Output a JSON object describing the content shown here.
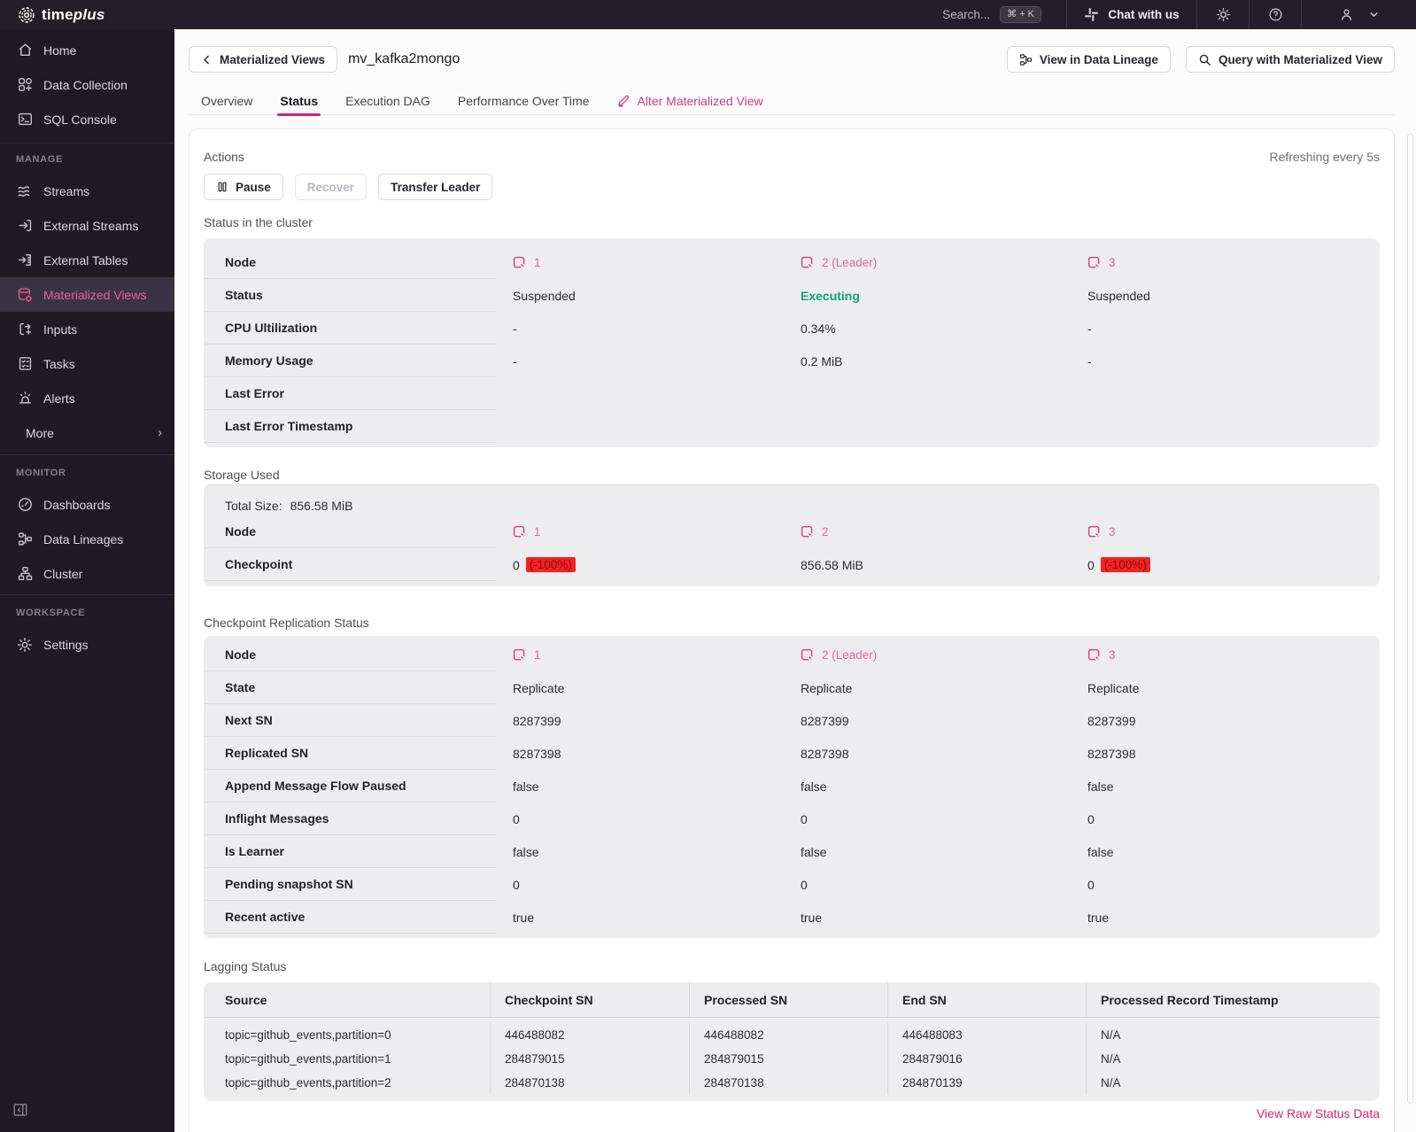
{
  "colors": {
    "brand_pink": "#d6246d",
    "node_pink": "#e2699c",
    "green_executing": "#0ea371",
    "error_badge_bg": "#f42121",
    "error_badge_text": "#7e1111",
    "sidebar_bg": "#1e1b26",
    "topbar_bg": "#221f2a"
  },
  "brand": {
    "name_regular": "time",
    "name_italic": "plus",
    "icon": "timeplus-rings-icon"
  },
  "topbar": {
    "search_label": "Search...",
    "search_shortcut": "⌘ + K",
    "chat_label": "Chat with us",
    "icons": [
      "slack-icon",
      "sun-icon",
      "help-icon",
      "user-icon",
      "chevron-down-icon"
    ]
  },
  "sidebar": {
    "primary": [
      {
        "label": "Home",
        "icon": "home-icon"
      },
      {
        "label": "Data Collection",
        "icon": "data-collection-icon"
      },
      {
        "label": "SQL Console",
        "icon": "sql-console-icon"
      }
    ],
    "sections": [
      {
        "title": "MANAGE",
        "items": [
          {
            "label": "Streams",
            "icon": "streams-icon"
          },
          {
            "label": "External Streams",
            "icon": "external-streams-icon"
          },
          {
            "label": "External Tables",
            "icon": "external-tables-icon"
          },
          {
            "label": "Materialized Views",
            "icon": "materialized-views-icon",
            "active": true
          },
          {
            "label": "Inputs",
            "icon": "inputs-icon"
          },
          {
            "label": "Tasks",
            "icon": "tasks-icon"
          },
          {
            "label": "Alerts",
            "icon": "alerts-icon"
          },
          {
            "label": "More",
            "icon": "",
            "chevron": "›"
          }
        ]
      },
      {
        "title": "MONITOR",
        "items": [
          {
            "label": "Dashboards",
            "icon": "dashboards-icon"
          },
          {
            "label": "Data Lineages",
            "icon": "data-lineages-icon"
          },
          {
            "label": "Cluster",
            "icon": "cluster-icon"
          }
        ]
      },
      {
        "title": "WORKSPACE",
        "items": [
          {
            "label": "Settings",
            "icon": "settings-icon"
          }
        ]
      }
    ]
  },
  "header": {
    "back_label": "Materialized Views",
    "title": "mv_kafka2mongo",
    "lineage_button": "View in Data Lineage",
    "query_button": "Query with Materialized View"
  },
  "tabs": {
    "items": [
      {
        "label": "Overview"
      },
      {
        "label": "Status",
        "active": true
      },
      {
        "label": "Execution DAG"
      },
      {
        "label": "Performance Over Time"
      }
    ],
    "alter_label": "Alter Materialized View"
  },
  "panel": {
    "actions_title": "Actions",
    "refresh_note": "Refreshing every 5s",
    "pause_label": "Pause",
    "recover_label": "Recover",
    "transfer_label": "Transfer Leader",
    "cluster": {
      "title": "Status in the cluster",
      "labels": {
        "node": "Node",
        "status": "Status",
        "cpu": "CPU Ultilization",
        "memory": "Memory Usage",
        "last_error": "Last Error",
        "last_error_ts": "Last Error Timestamp"
      },
      "nodes": [
        {
          "id": "1",
          "status": "Suspended",
          "cpu": "-",
          "memory": "-",
          "last_error": "",
          "last_error_ts": ""
        },
        {
          "id": "2 (Leader)",
          "status": "Executing",
          "cpu": "0.34%",
          "memory": "0.2 MiB",
          "last_error": "",
          "last_error_ts": ""
        },
        {
          "id": "3",
          "status": "Suspended",
          "cpu": "-",
          "memory": "-",
          "last_error": "",
          "last_error_ts": ""
        }
      ]
    },
    "storage": {
      "title": "Storage Used",
      "total_label": "Total Size:",
      "total_value": "856.58 MiB",
      "labels": {
        "node": "Node",
        "checkpoint": "Checkpoint"
      },
      "nodes": [
        {
          "id": "1",
          "checkpoint": "0",
          "badge": "(-100%)"
        },
        {
          "id": "2",
          "checkpoint": "856.58 MiB",
          "badge": ""
        },
        {
          "id": "3",
          "checkpoint": "0",
          "badge": "(-100%)"
        }
      ]
    },
    "replication": {
      "title": "Checkpoint Replication Status",
      "labels": {
        "node": "Node",
        "state": "State",
        "next_sn": "Next SN",
        "replicated_sn": "Replicated SN",
        "append_paused": "Append Message Flow Paused",
        "inflight": "Inflight Messages",
        "is_learner": "Is Learner",
        "pending_sn": "Pending snapshot SN",
        "recent_active": "Recent active"
      },
      "nodes": [
        {
          "id": "1",
          "state": "Replicate",
          "next_sn": "8287399",
          "replicated_sn": "8287398",
          "append_paused": "false",
          "inflight": "0",
          "is_learner": "false",
          "pending_sn": "0",
          "recent_active": "true"
        },
        {
          "id": "2 (Leader)",
          "state": "Replicate",
          "next_sn": "8287399",
          "replicated_sn": "8287398",
          "append_paused": "false",
          "inflight": "0",
          "is_learner": "false",
          "pending_sn": "0",
          "recent_active": "true"
        },
        {
          "id": "3",
          "state": "Replicate",
          "next_sn": "8287399",
          "replicated_sn": "8287398",
          "append_paused": "false",
          "inflight": "0",
          "is_learner": "false",
          "pending_sn": "0",
          "recent_active": "true"
        }
      ]
    },
    "lagging": {
      "title": "Lagging Status",
      "columns": [
        "Source",
        "Checkpoint SN",
        "Processed SN",
        "End SN",
        "Processed Record Timestamp"
      ],
      "rows": [
        [
          "topic=github_events,partition=0",
          "446488082",
          "446488082",
          "446488083",
          "N/A"
        ],
        [
          "topic=github_events,partition=1",
          "284879015",
          "284879015",
          "284879016",
          "N/A"
        ],
        [
          "topic=github_events,partition=2",
          "284870138",
          "284870138",
          "284870139",
          "N/A"
        ]
      ]
    },
    "raw_link": "View Raw Status Data"
  }
}
